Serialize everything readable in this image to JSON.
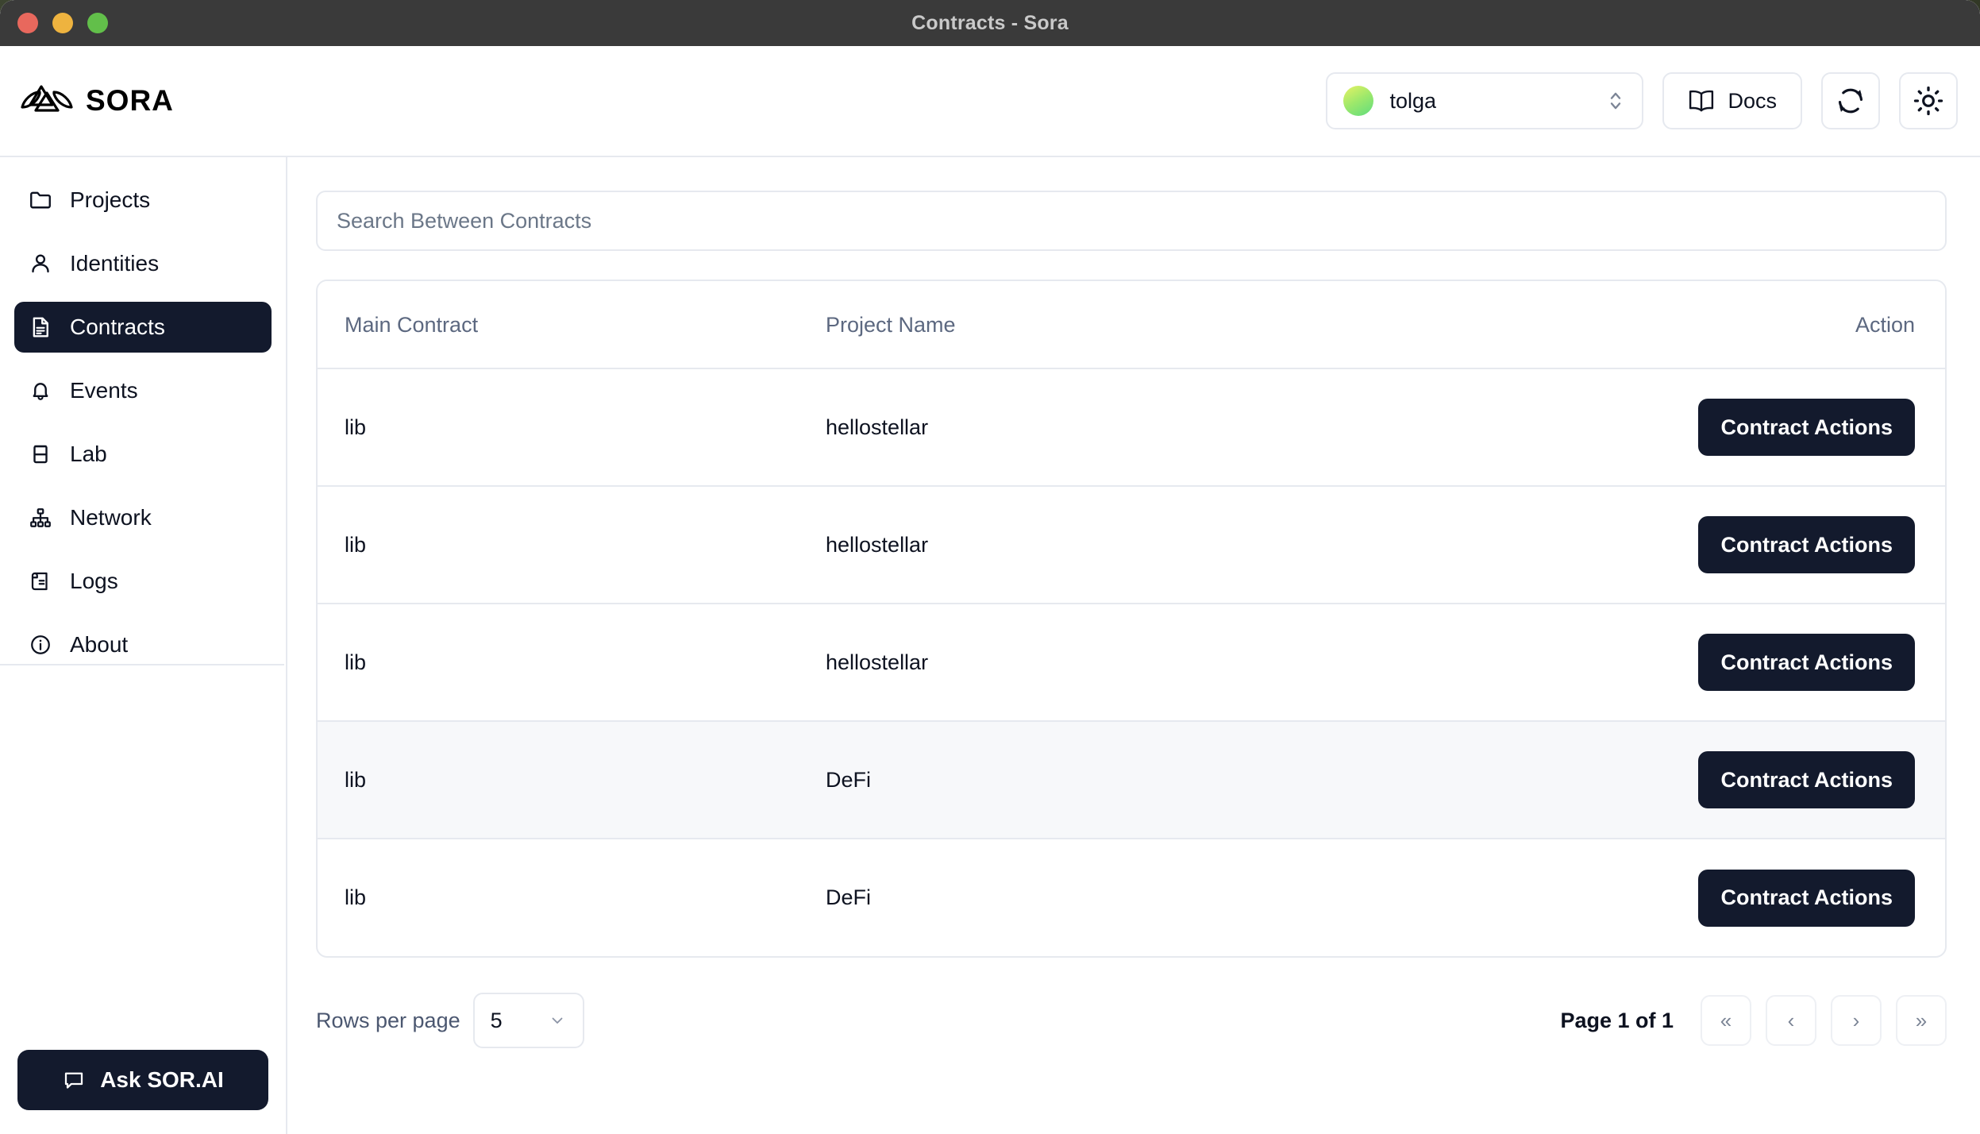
{
  "window": {
    "title": "Contracts - Sora",
    "traffic_lights": [
      "close",
      "minimize",
      "maximize"
    ]
  },
  "header": {
    "brand": "SORA",
    "logo_icon": "sora-mountain-logo",
    "account": {
      "name": "tolga",
      "avatar_gradient_from": "#e7f264",
      "avatar_gradient_to": "#5fdc7e",
      "chevron_icon": "chevron-up-down-icon"
    },
    "docs": {
      "label": "Docs",
      "icon": "book-open-icon"
    },
    "refresh": {
      "icon": "refresh-icon"
    },
    "theme": {
      "icon": "sun-icon"
    }
  },
  "sidebar": {
    "items": [
      {
        "label": "Projects",
        "icon": "folder-icon",
        "active": false
      },
      {
        "label": "Identities",
        "icon": "user-icon",
        "active": false
      },
      {
        "label": "Contracts",
        "icon": "document-icon",
        "active": true
      },
      {
        "label": "Events",
        "icon": "bell-icon",
        "active": false
      },
      {
        "label": "Lab",
        "icon": "flask-icon",
        "active": false
      },
      {
        "label": "Network",
        "icon": "sitemap-icon",
        "active": false
      },
      {
        "label": "Logs",
        "icon": "scroll-icon",
        "active": false
      },
      {
        "label": "About",
        "icon": "info-icon",
        "active": false
      }
    ],
    "ask_button": {
      "label": "Ask SOR.AI",
      "icon": "chat-bubble-icon"
    }
  },
  "main": {
    "search": {
      "placeholder": "Search Between Contracts",
      "value": ""
    },
    "table": {
      "columns": [
        "Main Contract",
        "Project Name",
        "Action"
      ],
      "rows": [
        {
          "main_contract": "lib",
          "project_name": "hellostellar",
          "action_label": "Contract Actions",
          "highlighted": false
        },
        {
          "main_contract": "lib",
          "project_name": "hellostellar",
          "action_label": "Contract Actions",
          "highlighted": false
        },
        {
          "main_contract": "lib",
          "project_name": "hellostellar",
          "action_label": "Contract Actions",
          "highlighted": false
        },
        {
          "main_contract": "lib",
          "project_name": "DeFi",
          "action_label": "Contract Actions",
          "highlighted": true
        },
        {
          "main_contract": "lib",
          "project_name": "DeFi",
          "action_label": "Contract Actions",
          "highlighted": false
        }
      ]
    },
    "pagination": {
      "rows_per_page_label": "Rows per page",
      "rows_per_page_value": "5",
      "rows_per_page_chevron": "chevron-down-icon",
      "page_label": "Page 1 of 1",
      "first_label": "«",
      "prev_label": "‹",
      "next_label": "›",
      "last_label": "»"
    }
  },
  "colors": {
    "accent_dark": "#131a2d",
    "border": "#e6e9ef",
    "muted_text": "#5c6880",
    "titlebar": "#3a3a3a"
  }
}
